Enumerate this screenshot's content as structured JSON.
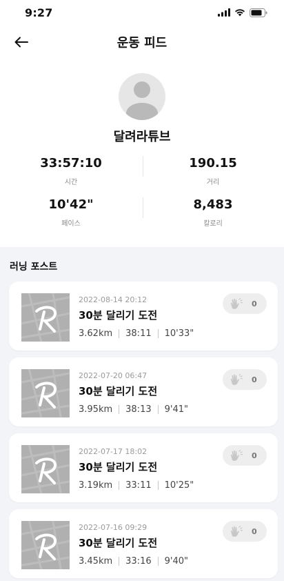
{
  "status_bar": {
    "time": "9:27"
  },
  "header": {
    "title": "운동 피드"
  },
  "profile": {
    "name": "달려라튜브"
  },
  "stats": [
    {
      "value": "33:57:10",
      "label": "시간"
    },
    {
      "value": "190.15",
      "label": "거리"
    },
    {
      "value": "10'42\"",
      "label": "페이스"
    },
    {
      "value": "8,483",
      "label": "칼로리"
    }
  ],
  "feed": {
    "title": "러닝 포스트",
    "posts": [
      {
        "date": "2022-08-14 20:12",
        "title": "30분 달리기 도전",
        "distance": "3.62km",
        "time": "38:11",
        "pace": "10'33\"",
        "likes": "0"
      },
      {
        "date": "2022-07-20 06:47",
        "title": "30분 달리기 도전",
        "distance": "3.95km",
        "time": "38:13",
        "pace": "9'41\"",
        "likes": "0"
      },
      {
        "date": "2022-07-17 18:02",
        "title": "30분 달리기 도전",
        "distance": "3.19km",
        "time": "33:11",
        "pace": "10'25\"",
        "likes": "0"
      },
      {
        "date": "2022-07-16 09:29",
        "title": "30분 달리기 도전",
        "distance": "3.45km",
        "time": "33:16",
        "pace": "9'40\"",
        "likes": "0"
      }
    ]
  },
  "icons": {
    "back": "arrow-left-icon",
    "like": "clap-icon",
    "thumbnail": "map-thumbnail"
  },
  "colors": {
    "feed_bg": "#f3f4f7",
    "thumb_bg": "#b0b0b0",
    "like_pill": "#eeeeee"
  }
}
